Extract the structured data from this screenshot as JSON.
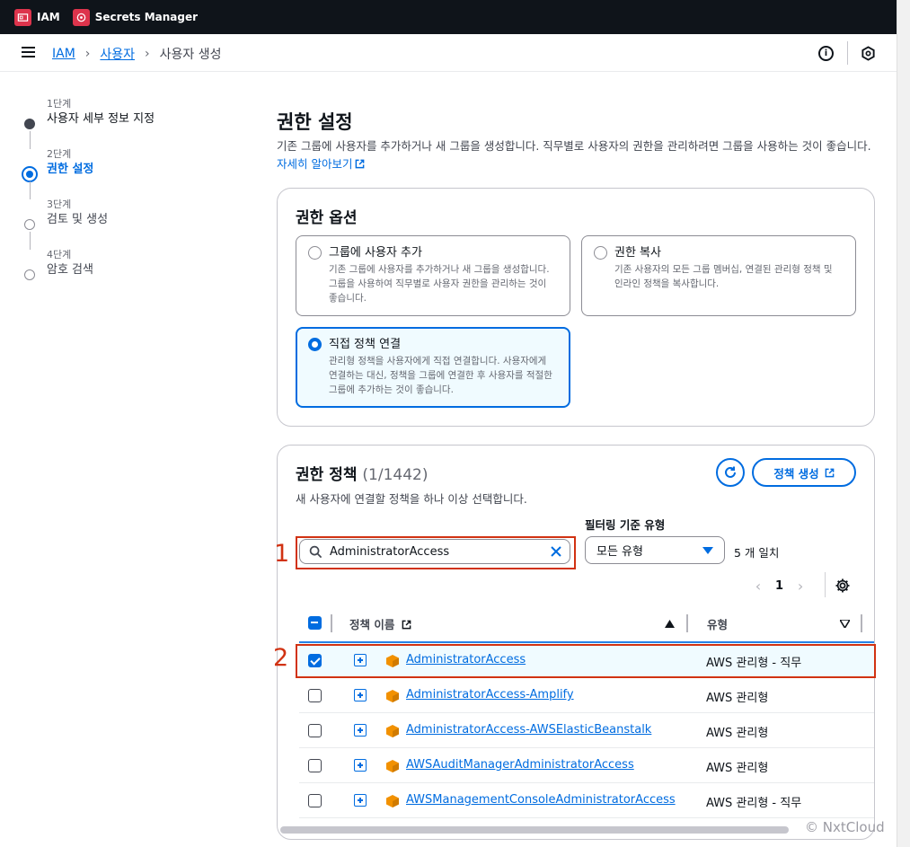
{
  "topbar": {
    "services": [
      {
        "label": "IAM",
        "icon": "iam-icon"
      },
      {
        "label": "Secrets Manager",
        "icon": "secrets-manager-icon"
      }
    ]
  },
  "breadcrumb": {
    "items": [
      "IAM",
      "사용자",
      "사용자 생성"
    ]
  },
  "steps": [
    {
      "num": "1단계",
      "label": "사용자 세부 정보 지정",
      "state": "done"
    },
    {
      "num": "2단계",
      "label": "권한 설정",
      "state": "active"
    },
    {
      "num": "3단계",
      "label": "검토 및 생성",
      "state": "todo"
    },
    {
      "num": "4단계",
      "label": "암호 검색",
      "state": "todo"
    }
  ],
  "page": {
    "title": "권한 설정",
    "description": "기존 그룹에 사용자를 추가하거나 새 그룹을 생성합니다. 직무별로 사용자의 권한을 관리하려면 그룹을 사용하는 것이 좋습니다.",
    "learn_more": "자세히 알아보기"
  },
  "options_panel": {
    "title": "권한 옵션",
    "options": [
      {
        "title": "그룹에 사용자 추가",
        "desc": "기존 그룹에 사용자를 추가하거나 새 그룹을 생성합니다. 그룹을 사용하여 직무별로 사용자 권한을 관리하는 것이 좋습니다.",
        "selected": false
      },
      {
        "title": "권한 복사",
        "desc": "기존 사용자의 모든 그룹 멤버십, 연결된 관리형 정책 및 인라인 정책을 복사합니다.",
        "selected": false
      },
      {
        "title": "직접 정책 연결",
        "desc": "관리형 정책을 사용자에게 직접 연결합니다. 사용자에게 연결하는 대신, 정책을 그룹에 연결한 후 사용자를 적절한 그룹에 추가하는 것이 좋습니다.",
        "selected": true
      }
    ]
  },
  "policies_panel": {
    "title": "권한 정책",
    "count": "(1/1442)",
    "subtitle": "새 사용자에 연결할 정책을 하나 이상 선택합니다.",
    "create_button": "정책 생성",
    "search_value": "AdministratorAccess",
    "filter_label": "필터링 기준 유형",
    "filter_value": "모든 유형",
    "matches": "5 개 일치",
    "page": "1",
    "col_name": "정책 이름",
    "col_type": "유형",
    "rows": [
      {
        "name": "AdministratorAccess",
        "type": "AWS 관리형 - 직무",
        "checked": true
      },
      {
        "name": "AdministratorAccess-Amplify",
        "type": "AWS 관리형",
        "checked": false
      },
      {
        "name": "AdministratorAccess-AWSElasticBeanstalk",
        "type": "AWS 관리형",
        "checked": false
      },
      {
        "name": "AWSAuditManagerAdministratorAccess",
        "type": "AWS 관리형",
        "checked": false
      },
      {
        "name": "AWSManagementConsoleAdministratorAccess",
        "type": "AWS 관리형 - 직무",
        "checked": false
      }
    ]
  },
  "annotations": [
    "1",
    "2"
  ],
  "watermark": "© NxtCloud",
  "colors": {
    "accent": "#006ce0",
    "annotation_red": "#d13212",
    "service_icon": "#dd344c",
    "policy_icon": "#f29100"
  }
}
